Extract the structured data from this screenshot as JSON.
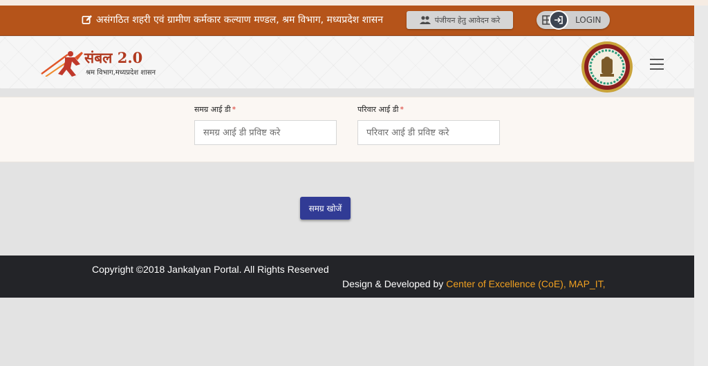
{
  "topbar": {
    "title": "असंगठित शहरी एवं ग्रामीण कर्मकार कल्याण मण्डल, श्रम विभाग, मध्यप्रदेश शासन",
    "register_label": "पंजीयन हेतु आवेदन करे",
    "login_label": "LOGIN"
  },
  "header": {
    "logo_title": "संबल 2.0",
    "logo_subtitle": "श्रम विभाग,मध्यप्रदेश शासन"
  },
  "form": {
    "samagra_label": "समग्र आई डी",
    "samagra_placeholder": "समग्र आई डी प्रविष्ट करे",
    "samagra_value": "",
    "parivar_label": "परिवार आई डी",
    "parivar_placeholder": "परिवार आई डी प्रविष्ट करे",
    "parivar_value": "",
    "required_mark": "*",
    "search_label": "समग्र खोजें"
  },
  "footer": {
    "copyright": "Copyright ©2018 Jankalyan Portal. All Rights Reserved",
    "designed_prefix": "Design & Developed by ",
    "designed_org": "Center of Excellence (CoE), MAP_IT,"
  },
  "colors": {
    "topbar": "#b5541a",
    "primary_button": "#313b95",
    "footer_bg": "#232428",
    "footer_link": "#f0a020",
    "logo_text": "#b13a20"
  },
  "icons": {
    "title": "edit-icon",
    "register": "users-icon",
    "login": "sign-in-icon",
    "menu": "hamburger-icon"
  }
}
